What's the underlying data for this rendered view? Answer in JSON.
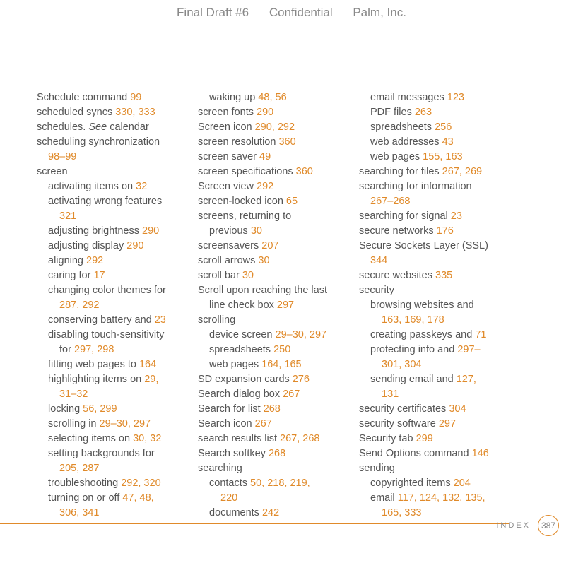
{
  "header": {
    "draft": "Final Draft #6",
    "conf": "Confidential",
    "company": "Palm, Inc."
  },
  "footer": {
    "label": "INDEX",
    "page": "387"
  },
  "columns": [
    [
      {
        "t": "Schedule command ",
        "p": "99",
        "i": 0
      },
      {
        "t": "scheduled syncs ",
        "p": "330, 333",
        "i": 0
      },
      {
        "t": "schedules. ",
        "see": "See ",
        "after": "calendar",
        "i": 0
      },
      {
        "t": "scheduling synchronization",
        "i": 0
      },
      {
        "t": "",
        "p": "98–99",
        "i": 1
      },
      {
        "t": "screen",
        "i": 0
      },
      {
        "t": "activating items on ",
        "p": "32",
        "i": 1
      },
      {
        "t": "activating wrong features",
        "i": 1
      },
      {
        "t": "",
        "p": "321",
        "i": 2
      },
      {
        "t": "adjusting brightness ",
        "p": "290",
        "i": 1
      },
      {
        "t": "adjusting display ",
        "p": "290",
        "i": 1
      },
      {
        "t": "aligning ",
        "p": "292",
        "i": 1
      },
      {
        "t": "caring for ",
        "p": "17",
        "i": 1
      },
      {
        "t": "changing color themes for",
        "i": 1
      },
      {
        "t": "",
        "p": "287, 292",
        "i": 2
      },
      {
        "t": "conserving battery and ",
        "p": "23",
        "i": 1
      },
      {
        "t": "disabling touch-sensitivity",
        "i": 1
      },
      {
        "t": "for ",
        "p": "297, 298",
        "i": 2
      },
      {
        "t": "fitting web pages to ",
        "p": "164",
        "i": 1
      },
      {
        "t": "highlighting items on ",
        "p": "29,",
        "i": 1
      },
      {
        "t": "",
        "p": "31–32",
        "i": 2
      },
      {
        "t": "locking ",
        "p": "56, 299",
        "i": 1
      },
      {
        "t": "scrolling in ",
        "p": "29–30, 297",
        "i": 1
      },
      {
        "t": "selecting items on ",
        "p": "30, 32",
        "i": 1
      },
      {
        "t": "setting backgrounds for",
        "i": 1
      },
      {
        "t": "",
        "p": "205, 287",
        "i": 2
      },
      {
        "t": "troubleshooting ",
        "p": "292, 320",
        "i": 1
      },
      {
        "t": "turning on or off ",
        "p": "47, 48,",
        "i": 1
      },
      {
        "t": "",
        "p": "306, 341",
        "i": 2
      }
    ],
    [
      {
        "t": "waking up ",
        "p": "48, 56",
        "i": 1
      },
      {
        "t": "screen fonts ",
        "p": "290",
        "i": 0
      },
      {
        "t": "Screen icon ",
        "p": "290, 292",
        "i": 0
      },
      {
        "t": "screen resolution ",
        "p": "360",
        "i": 0
      },
      {
        "t": "screen saver ",
        "p": "49",
        "i": 0
      },
      {
        "t": "screen specifications ",
        "p": "360",
        "i": 0
      },
      {
        "t": "Screen view ",
        "p": "292",
        "i": 0
      },
      {
        "t": "screen-locked icon ",
        "p": "65",
        "i": 0
      },
      {
        "t": "screens, returning to",
        "i": 0
      },
      {
        "t": "previous ",
        "p": "30",
        "i": 1
      },
      {
        "t": "screensavers ",
        "p": "207",
        "i": 0
      },
      {
        "t": "scroll arrows ",
        "p": "30",
        "i": 0
      },
      {
        "t": "scroll bar ",
        "p": "30",
        "i": 0
      },
      {
        "t": "Scroll upon reaching the last",
        "i": 0
      },
      {
        "t": "line check box ",
        "p": "297",
        "i": 1
      },
      {
        "t": "scrolling",
        "i": 0
      },
      {
        "t": "device screen ",
        "p": "29–30, 297",
        "i": 1
      },
      {
        "t": "spreadsheets ",
        "p": "250",
        "i": 1
      },
      {
        "t": "web pages ",
        "p": "164, 165",
        "i": 1
      },
      {
        "t": "SD expansion cards ",
        "p": "276",
        "i": 0
      },
      {
        "t": "Search dialog box ",
        "p": "267",
        "i": 0
      },
      {
        "t": "Search for list ",
        "p": "268",
        "i": 0
      },
      {
        "t": "Search icon ",
        "p": "267",
        "i": 0
      },
      {
        "t": "search results list ",
        "p": "267, 268",
        "i": 0
      },
      {
        "t": "Search softkey ",
        "p": "268",
        "i": 0
      },
      {
        "t": "searching",
        "i": 0
      },
      {
        "t": "contacts ",
        "p": "50, 218, 219,",
        "i": 1
      },
      {
        "t": "",
        "p": "220",
        "i": 2
      },
      {
        "t": "documents ",
        "p": "242",
        "i": 1
      }
    ],
    [
      {
        "t": "email messages ",
        "p": "123",
        "i": 1
      },
      {
        "t": "PDF files ",
        "p": "263",
        "i": 1
      },
      {
        "t": "spreadsheets ",
        "p": "256",
        "i": 1
      },
      {
        "t": "web addresses ",
        "p": "43",
        "i": 1
      },
      {
        "t": "web pages ",
        "p": "155, 163",
        "i": 1
      },
      {
        "t": "searching for files ",
        "p": "267, 269",
        "i": 0
      },
      {
        "t": "searching for information",
        "i": 0
      },
      {
        "t": "",
        "p": "267–268",
        "i": 1
      },
      {
        "t": "searching for signal ",
        "p": "23",
        "i": 0
      },
      {
        "t": "secure networks ",
        "p": "176",
        "i": 0
      },
      {
        "t": "Secure Sockets Layer (SSL)",
        "i": 0
      },
      {
        "t": "",
        "p": "344",
        "i": 1
      },
      {
        "t": "secure websites ",
        "p": "335",
        "i": 0
      },
      {
        "t": "security",
        "i": 0
      },
      {
        "t": "browsing websites and",
        "i": 1
      },
      {
        "t": "",
        "p": "163, 169, 178",
        "i": 2
      },
      {
        "t": "creating passkeys and ",
        "p": "71",
        "i": 1
      },
      {
        "t": "protecting info and ",
        "p": "297–",
        "i": 1
      },
      {
        "t": "",
        "p": "301, 304",
        "i": 2
      },
      {
        "t": "sending email and ",
        "p": "127,",
        "i": 1
      },
      {
        "t": "",
        "p": "131",
        "i": 2
      },
      {
        "t": "security certificates ",
        "p": "304",
        "i": 0
      },
      {
        "t": "security software ",
        "p": "297",
        "i": 0
      },
      {
        "t": "Security tab ",
        "p": "299",
        "i": 0
      },
      {
        "t": "Send Options command ",
        "p": "146",
        "i": 0
      },
      {
        "t": "sending",
        "i": 0
      },
      {
        "t": "copyrighted items ",
        "p": "204",
        "i": 1
      },
      {
        "t": "email ",
        "p": "117, 124, 132, 135,",
        "i": 1
      },
      {
        "t": "",
        "p": "165, 333",
        "i": 2
      }
    ]
  ]
}
